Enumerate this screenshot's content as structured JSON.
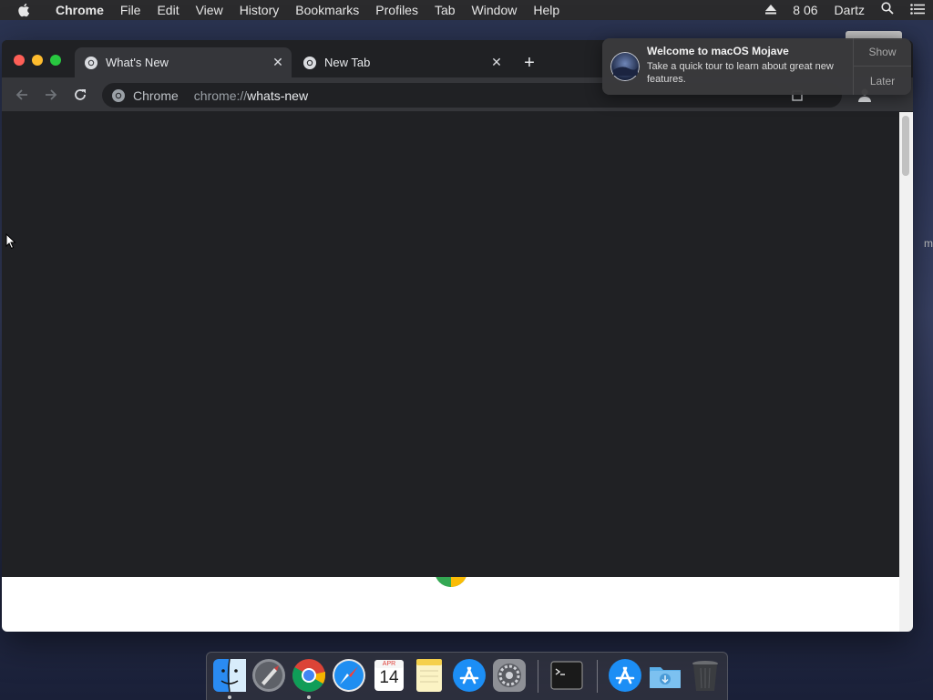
{
  "menubar": {
    "app_name": "Chrome",
    "items": [
      "File",
      "Edit",
      "View",
      "History",
      "Bookmarks",
      "Profiles",
      "Tab",
      "Window",
      "Help"
    ],
    "clock": "8 06",
    "user": "Dartz",
    "icons": [
      "apple-icon",
      "eject-icon",
      "spotlight-search-icon",
      "notification-center-icon"
    ]
  },
  "browser": {
    "tabs": [
      {
        "title": "What's New",
        "active": true
      },
      {
        "title": "New Tab",
        "active": false
      }
    ],
    "omnibox": {
      "site_name": "Chrome",
      "url_scheme": "chrome://",
      "url_host": "whats-new"
    }
  },
  "notification": {
    "title": "Welcome to macOS Mojave",
    "text": "Take a quick tour to learn about great new features.",
    "show_label": "Show",
    "later_label": "Later"
  },
  "desktop": {
    "edge_text": "m"
  },
  "dock": {
    "items": [
      "Finder",
      "Launchpad",
      "Google Chrome",
      "Safari",
      "Calendar",
      "Notes",
      "App Store",
      "System Preferences",
      "Terminal",
      "Applications",
      "Downloads",
      "Trash"
    ],
    "calendar_month": "APR",
    "calendar_day": "14"
  },
  "colors": {
    "window_bg": "#202124",
    "toolbar_bg": "#35363a",
    "accent_red": "#fe5f57",
    "accent_yellow": "#febc2e",
    "accent_green": "#28c840"
  }
}
